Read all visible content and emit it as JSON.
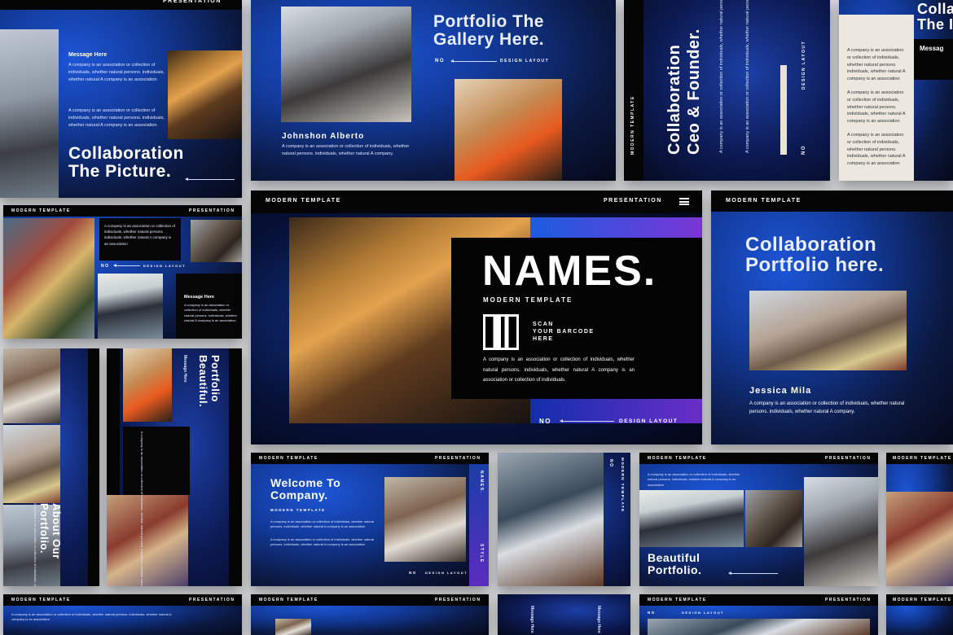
{
  "common": {
    "modern_template": "MODERN TEMPLATE",
    "presentation": "PRESENTATION",
    "no": "NO",
    "design_layout": "DESIGN LAYOUT",
    "message_here": "Message Here",
    "body_short": "A company is an association or collection of individuals, whether natural persons. individuals, whether natural A company is an association",
    "body_long": "A company is an association or collection of individuals, whether natural persons. individuals, whether natural A company. A company is an association or collection of individuals, whether natural persons."
  },
  "slide1": {
    "title_line1": "Collaboration",
    "title_line2": "The Picture.",
    "message": "Message Here"
  },
  "slide2": {
    "title_line1": "Portfolio The",
    "title_line2": "Gallery Here.",
    "name": "Johnshon Alberto",
    "desc": "A company is an association or collection of individuals, whether natural persons. individuals, whether natural A company."
  },
  "slide3": {
    "title_line1": "Collaboration",
    "title_line2": "Ceo & Founder."
  },
  "slide4": {
    "title_line1": "Colla",
    "title_line2": "The I",
    "message": "Messag"
  },
  "hero": {
    "title": "NAMES.",
    "subtitle": "MODERN TEMPLATE",
    "scan_line1": "SCAN",
    "scan_line2": "YOUR BARCODE",
    "scan_line3": "HERE",
    "body": "A company is an association or collection of individuals, whether natural persons. individuals, whether natural A company is an association or collection of individuals."
  },
  "slide_right": {
    "title_line1": "Collaboration",
    "title_line2": "Portfolio here.",
    "name": "Jessica Mila",
    "desc": "A company is an association or collection of individuals, whether natural persons. individuals, whether natural A company."
  },
  "slide_portfolio_beautiful": {
    "title_line1": "Portfolio",
    "title_line2": "Beautiful.",
    "message": "Message Here"
  },
  "slide_about": {
    "title_line1": "About Our",
    "title_line2": "Portfolio."
  },
  "slide_welcome": {
    "title_line1": "Welcome To",
    "title_line2": "Company.",
    "names": "NAMES.",
    "style": "STYLE"
  },
  "slide_beautiful": {
    "title_line1": "Beautiful",
    "title_line2": "Portfolio."
  }
}
